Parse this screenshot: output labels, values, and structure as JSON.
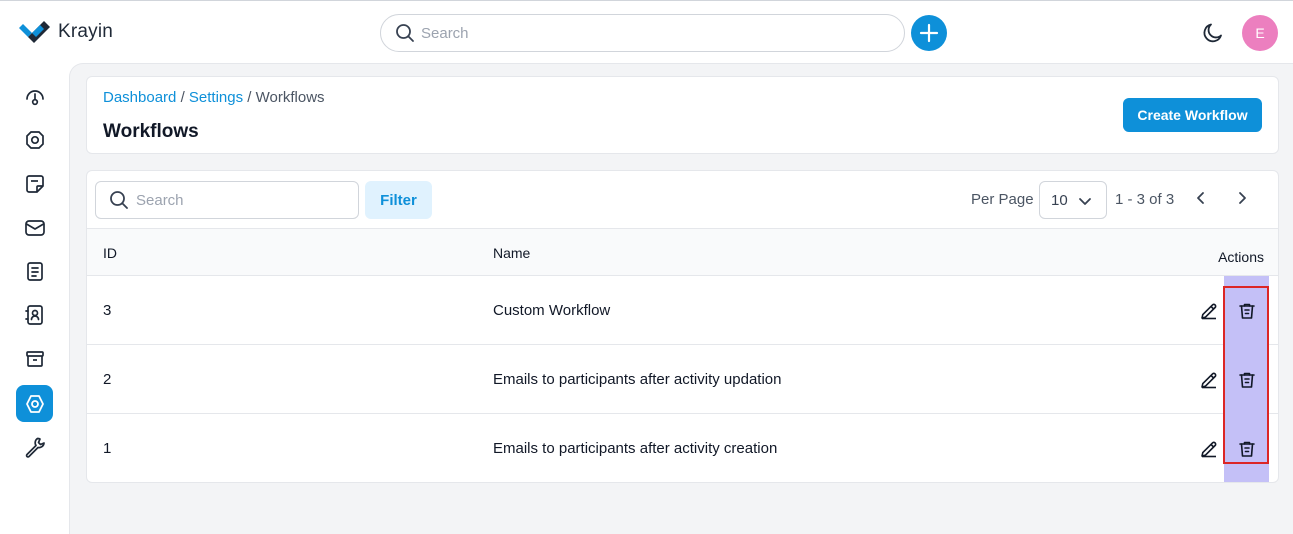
{
  "app": {
    "name": "Krayin"
  },
  "header": {
    "search_placeholder": "Search",
    "avatar_initial": "E"
  },
  "colors": {
    "accent": "#0e90d9",
    "avatar": "#ec7fbf",
    "highlight": "#c4c0f7",
    "annotation": "#dc2626"
  },
  "sidebar": {
    "items": [
      {
        "icon": "dashboard-gauge-icon"
      },
      {
        "icon": "leads-icon"
      },
      {
        "icon": "quotes-icon"
      },
      {
        "icon": "mail-icon"
      },
      {
        "icon": "activities-icon"
      },
      {
        "icon": "contacts-icon"
      },
      {
        "icon": "products-icon"
      },
      {
        "icon": "settings-icon",
        "active": true
      },
      {
        "icon": "configuration-wrench-icon"
      }
    ]
  },
  "breadcrumb": {
    "dashboard": "Dashboard",
    "settings": "Settings",
    "current": "Workflows",
    "sep": "/"
  },
  "page": {
    "title": "Workflows",
    "create_button": "Create Workflow"
  },
  "toolbar": {
    "search_placeholder": "Search",
    "filter_label": "Filter",
    "per_page_label": "Per Page",
    "per_page_value": "10",
    "pagination_info": "1 - 3 of 3"
  },
  "table": {
    "columns": {
      "id": "ID",
      "name": "Name",
      "actions": "Actions"
    },
    "rows": [
      {
        "id": "3",
        "name": "Custom Workflow"
      },
      {
        "id": "2",
        "name": "Emails to participants after activity updation"
      },
      {
        "id": "1",
        "name": "Emails to participants after activity creation"
      }
    ]
  }
}
